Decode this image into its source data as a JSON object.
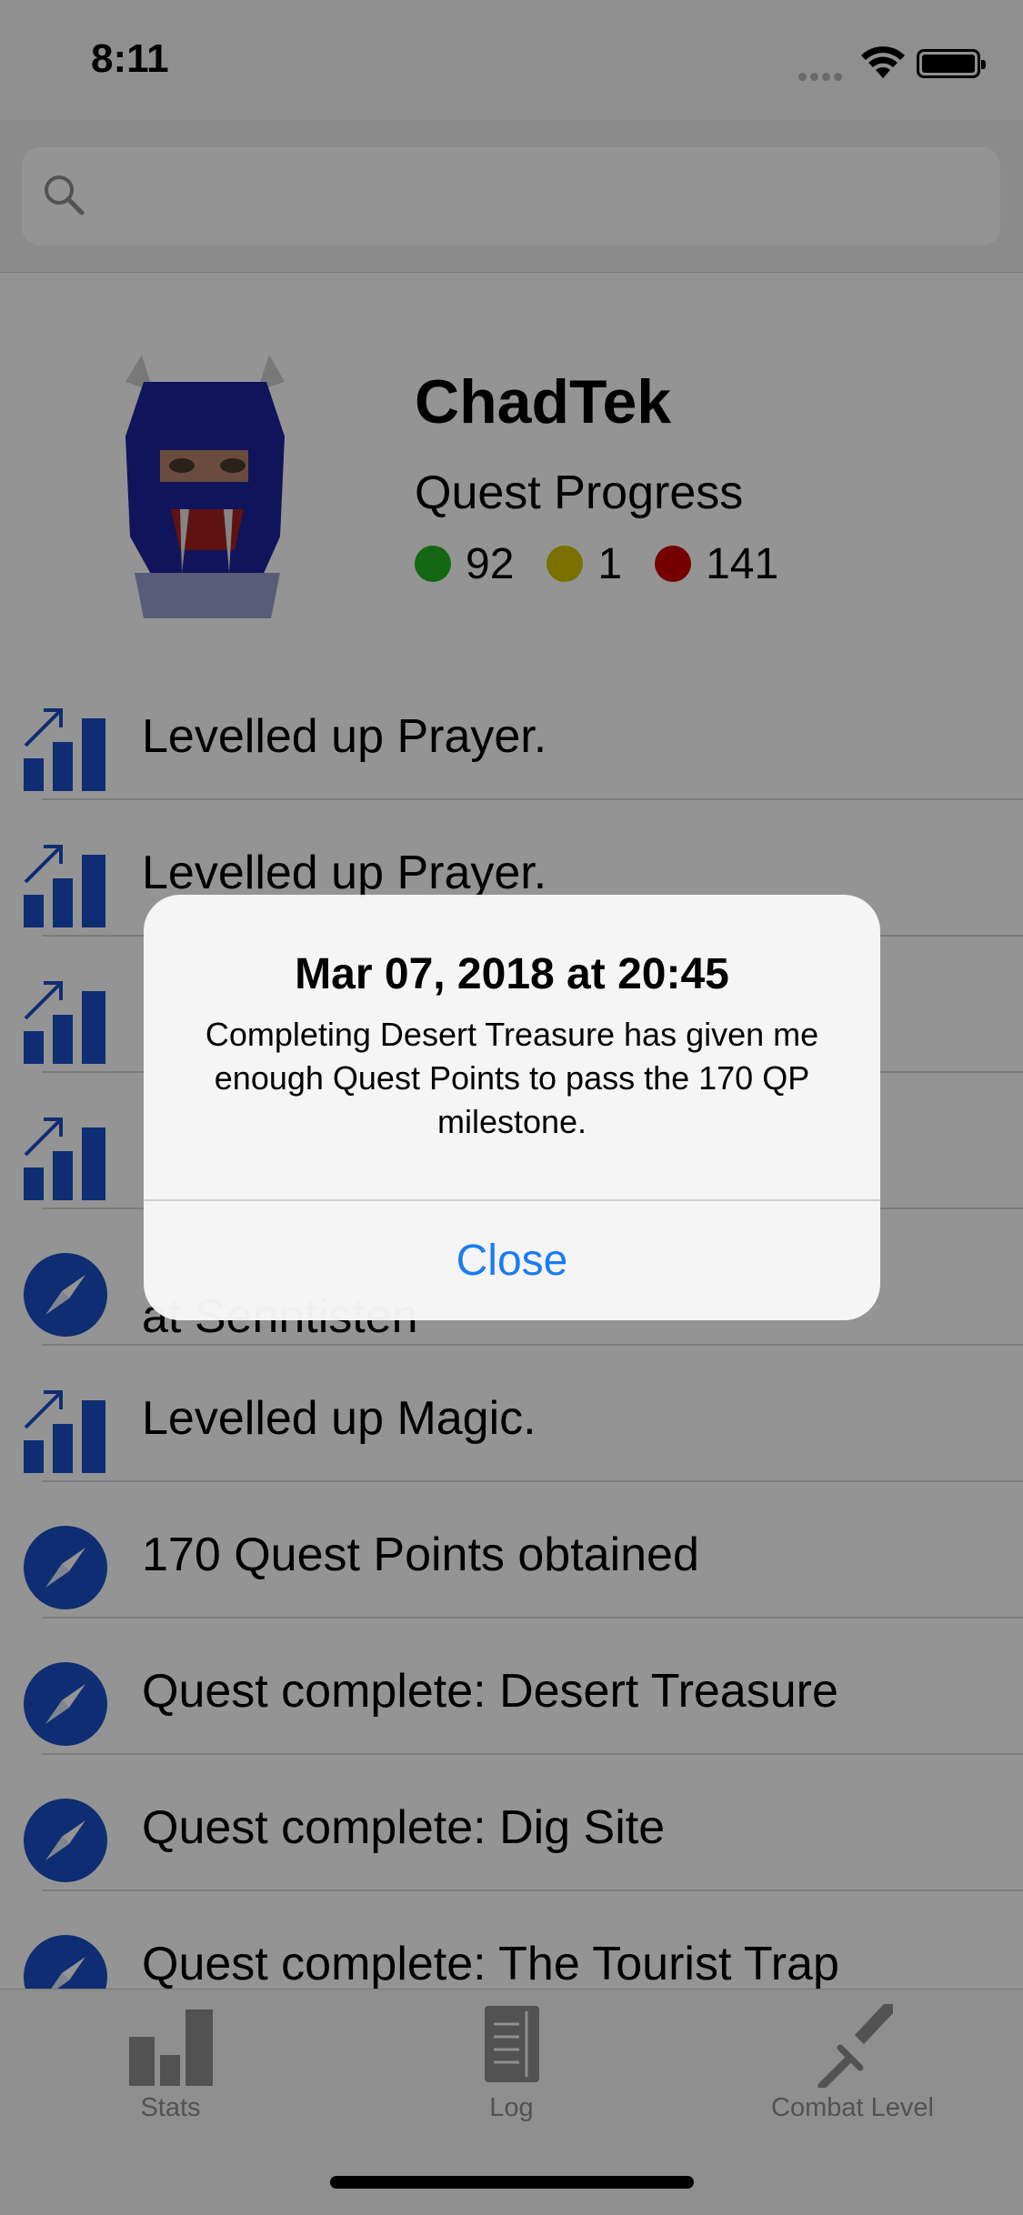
{
  "status_bar": {
    "time": "8:11"
  },
  "search": {
    "placeholder": "",
    "value": ""
  },
  "profile": {
    "name": "ChadTek",
    "quest_progress_label": "Quest Progress",
    "complete_count": "92",
    "in_progress_count": "1",
    "not_started_count": "141",
    "colors": {
      "complete": "#22b21f",
      "in_progress": "#d3c100",
      "not_started": "#cc0000"
    }
  },
  "log": {
    "items": [
      {
        "icon": "levelup-icon",
        "text": "Levelled up Prayer."
      },
      {
        "icon": "levelup-icon",
        "text": "Levelled up Prayer."
      },
      {
        "icon": "levelup-icon",
        "text": ""
      },
      {
        "icon": "levelup-icon",
        "text": ""
      },
      {
        "icon": "compass-icon",
        "text": "at Senntisten"
      },
      {
        "icon": "levelup-icon",
        "text": "Levelled up Magic."
      },
      {
        "icon": "compass-icon",
        "text": "170 Quest Points obtained"
      },
      {
        "icon": "compass-icon",
        "text": "Quest complete: Desert Treasure"
      },
      {
        "icon": "compass-icon",
        "text": "Quest complete: Dig Site"
      },
      {
        "icon": "compass-icon",
        "text": "Quest complete: The Tourist Trap"
      }
    ]
  },
  "tabs": [
    {
      "label": "Stats",
      "icon": "bar-chart-icon"
    },
    {
      "label": "Log",
      "icon": "notebook-icon"
    },
    {
      "label": "Combat Level",
      "icon": "sword-icon"
    }
  ],
  "alert": {
    "title": "Mar 07, 2018 at 20:45",
    "message": "Completing Desert Treasure has given me enough Quest Points to pass the 170 QP milestone.",
    "button": "Close"
  },
  "colors": {
    "accent": "#1a7cf2",
    "icon_blue": "#1a4fc4"
  }
}
